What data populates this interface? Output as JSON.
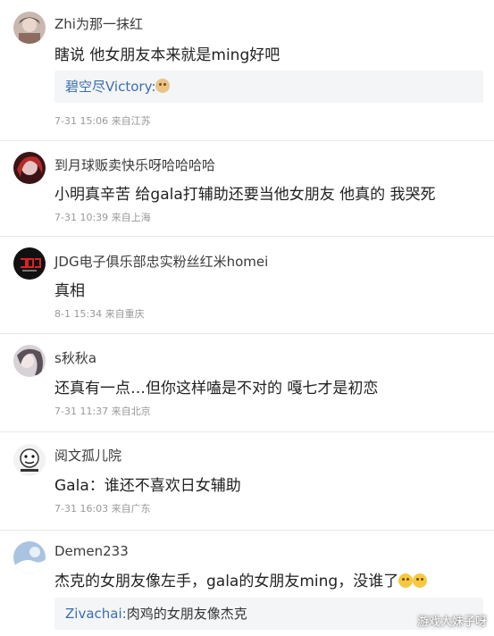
{
  "comments": [
    {
      "username": "Zhi为那一抹红",
      "text": "瞎说 他女朋友本来就是ming好吧",
      "reply": {
        "user": "碧空尽Victory",
        "separator": ":",
        "text": "",
        "emoji": "dog-emoji"
      },
      "date": "7-31 15:06",
      "location": "来自江苏",
      "avatar_color": "#c9b8b0"
    },
    {
      "username": "到月球贩卖快乐呀哈哈哈哈",
      "text": "小明真辛苦 给gala打辅助还要当他女朋友 他真的 我哭死",
      "date": "7-31 10:39",
      "location": "来自上海",
      "avatar_color": "#7a2a2a"
    },
    {
      "username": "JDG电子俱乐部忠实粉丝红米homei",
      "text": "真相",
      "date": "8-1 15:34",
      "location": "来自重庆",
      "avatar_color": "#111111"
    },
    {
      "username": "s秋秋a",
      "text": "还真有一点…但你这样嗑是不对的 嘎七才是初恋",
      "date": "7-31 11:37",
      "location": "来自北京",
      "avatar_color": "#d7d2d6"
    },
    {
      "username": "阅文孤儿院",
      "text": "Gala：谁还不喜欢日女辅助",
      "date": "7-31 16:03",
      "location": "来自广东",
      "avatar_color": "#f2f2f2"
    },
    {
      "username": "Demen233",
      "text": "杰克的女朋友像左手，gala的女朋友ming，没谁了",
      "text_emoji": "laugh-cry-emoji",
      "reply": {
        "user": "Zivachai",
        "separator": ":",
        "text": "肉鸡的女朋友像杰克"
      },
      "avatar_color": "#a9c4e0"
    }
  ],
  "watermark": "游戏大妹子呀"
}
